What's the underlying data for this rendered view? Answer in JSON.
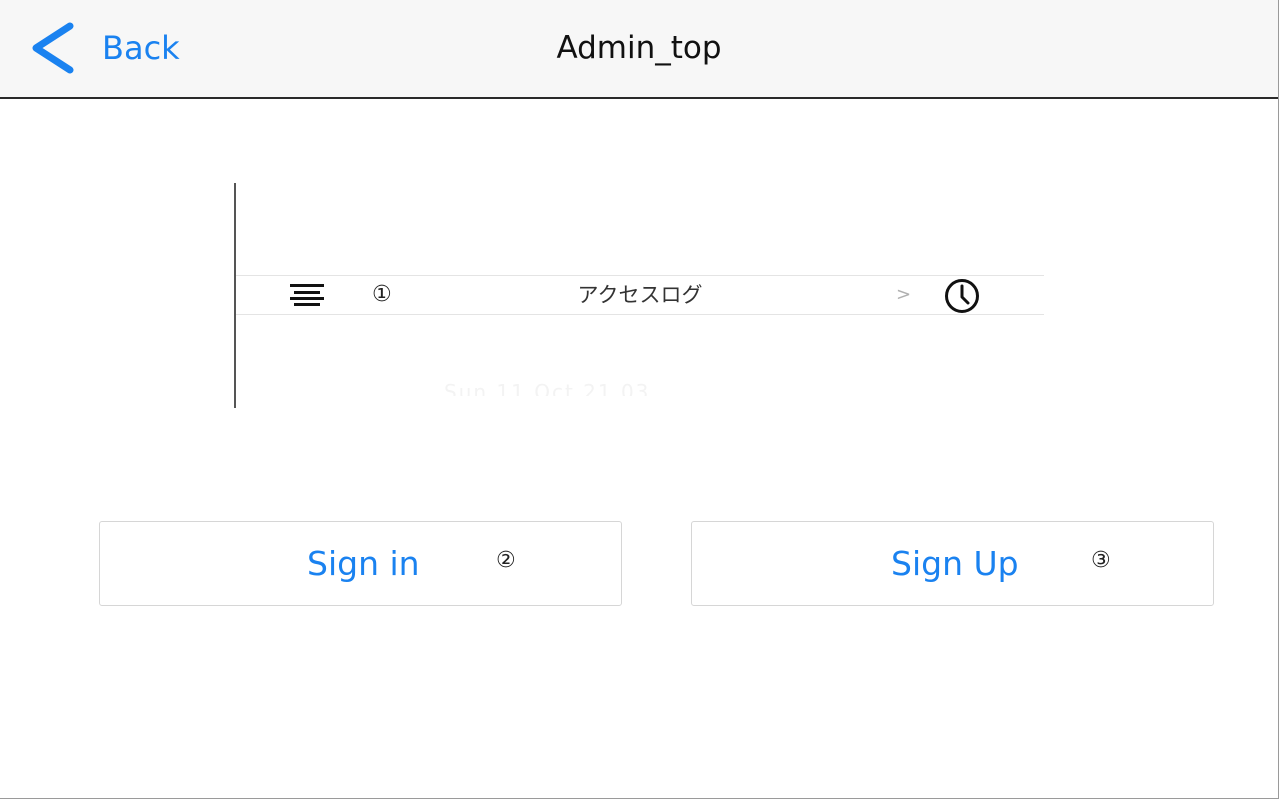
{
  "navbar": {
    "back_label": "Back",
    "title": "Admin_top"
  },
  "log_panel": {
    "row": {
      "badge": "①",
      "label": "アクセスログ",
      "chevron": ">",
      "left_icon": "hamburger-icon",
      "right_icon": "clock-icon"
    },
    "faded_text": "Sun 11 Oct    21          03"
  },
  "buttons": {
    "signin": {
      "label": "Sign in",
      "badge": "②"
    },
    "signup": {
      "label": "Sign Up",
      "badge": "③"
    }
  },
  "colors": {
    "accent": "#1a82f0",
    "navbar_bg": "#f7f7f7",
    "navbar_border": "#2a2a2a",
    "button_border": "#d6d6d6"
  }
}
